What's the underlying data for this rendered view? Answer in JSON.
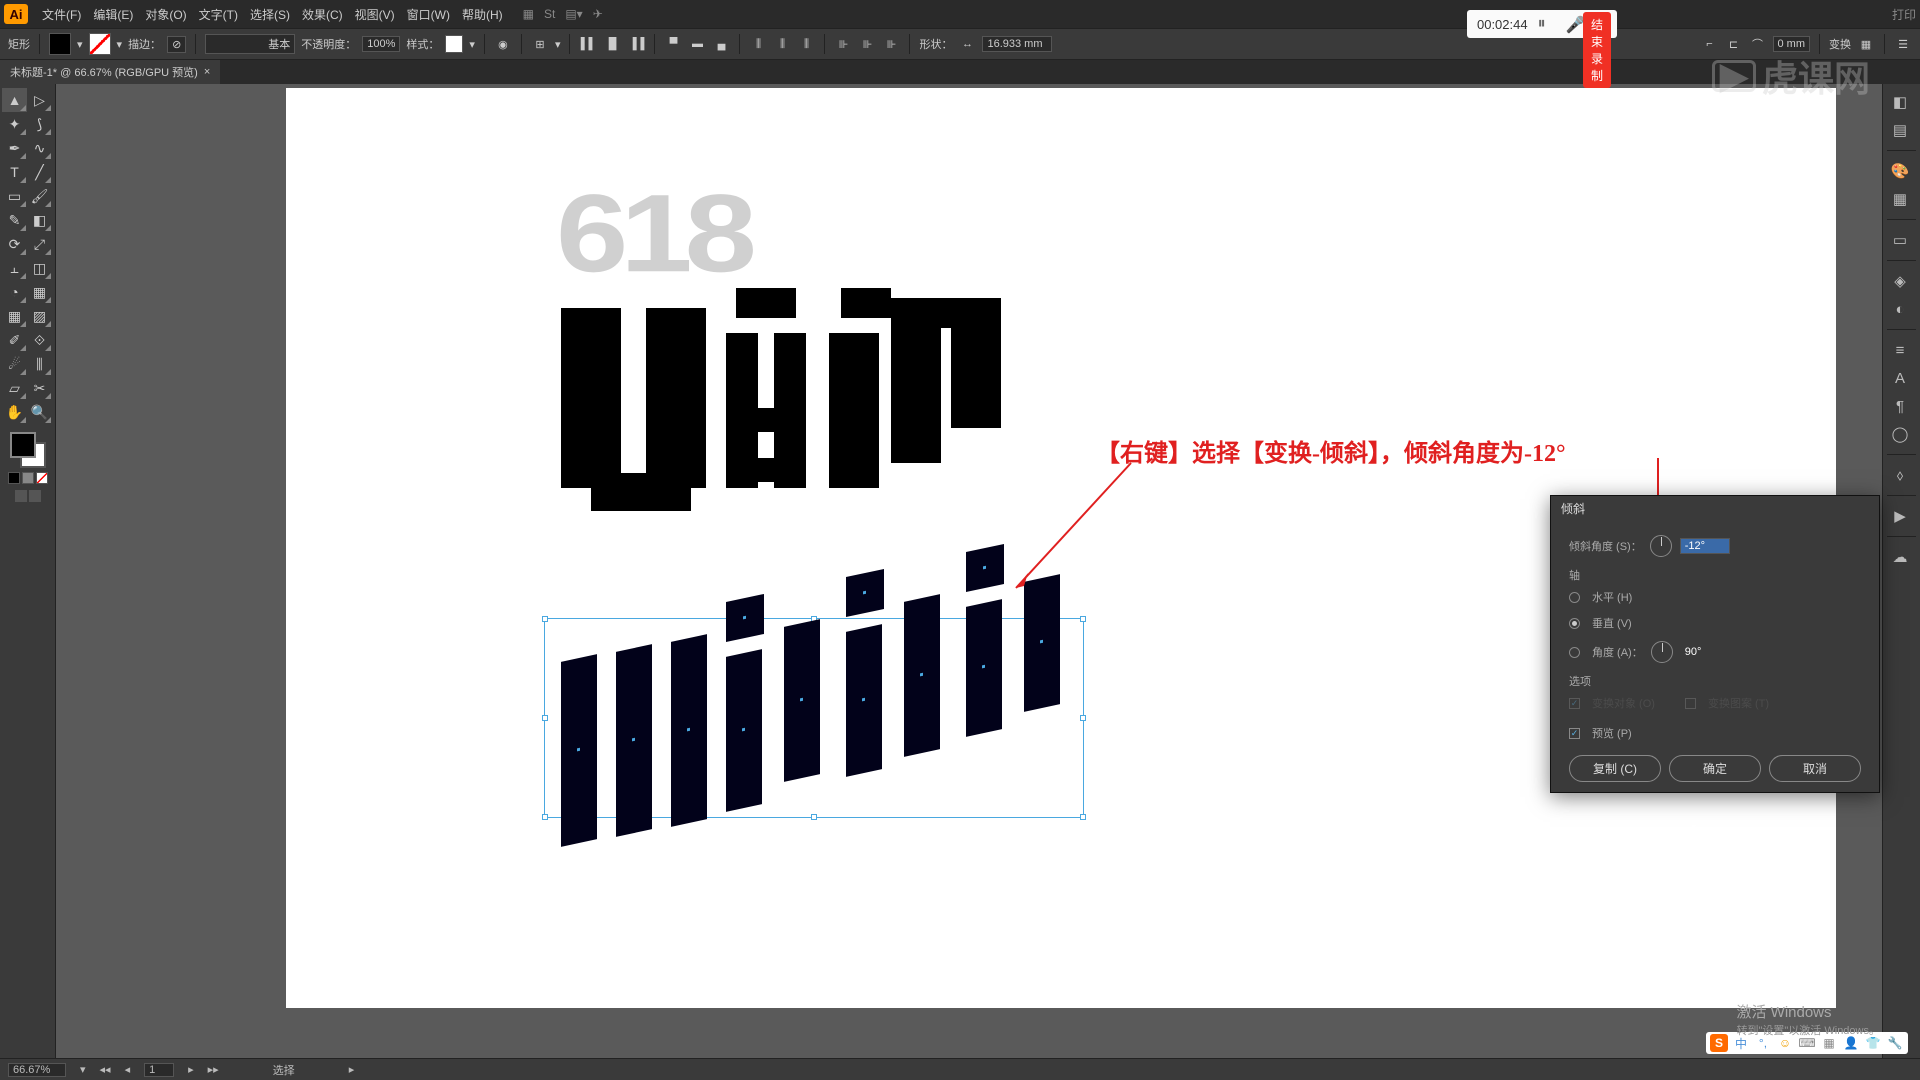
{
  "menu": {
    "items": [
      "文件(F)",
      "编辑(E)",
      "对象(O)",
      "文字(T)",
      "选择(S)",
      "效果(C)",
      "视图(V)",
      "窗口(W)",
      "帮助(H)"
    ],
    "right": "打印"
  },
  "controlbar": {
    "shape_label": "矩形",
    "stroke_label": "描边：",
    "stroke_icon": "⊘",
    "stroke_profile": "基本",
    "opacity_label": "不透明度：",
    "opacity_value": "100%",
    "style_label": "样式：",
    "shape_group_label": "形状：",
    "width_value": "16.933 mm",
    "gap_value": "0 mm",
    "transform_label": "变换"
  },
  "tab": {
    "title": "未标题-1* @ 66.67% (RGB/GPU 预览)"
  },
  "overlay": {
    "timer": "00:02:44",
    "rec": "结束录制"
  },
  "watermark": "虎课网",
  "annotation": "【右键】选择【变换-倾斜】，倾斜角度为-12°",
  "dialog": {
    "title": "倾斜",
    "angle_label": "倾斜角度 (S)：",
    "angle_value": "-12°",
    "axis_label": "轴",
    "horizontal": "水平 (H)",
    "vertical": "垂直 (V)",
    "angle2_label": "角度 (A)：",
    "angle2_value": "90°",
    "options_label": "选项",
    "opt_transform_obj": "变换对象 (O)",
    "opt_transform_pat": "变换图案 (T)",
    "preview": "预览 (P)",
    "btn_copy": "复制 (C)",
    "btn_ok": "确定",
    "btn_cancel": "取消"
  },
  "activate": {
    "title": "激活 Windows",
    "sub": "转到\"设置\"以激活 Windows。"
  },
  "statusbar": {
    "zoom": "66.67%",
    "page": "1",
    "mode": "选择"
  },
  "ime": {
    "lang": "中"
  }
}
